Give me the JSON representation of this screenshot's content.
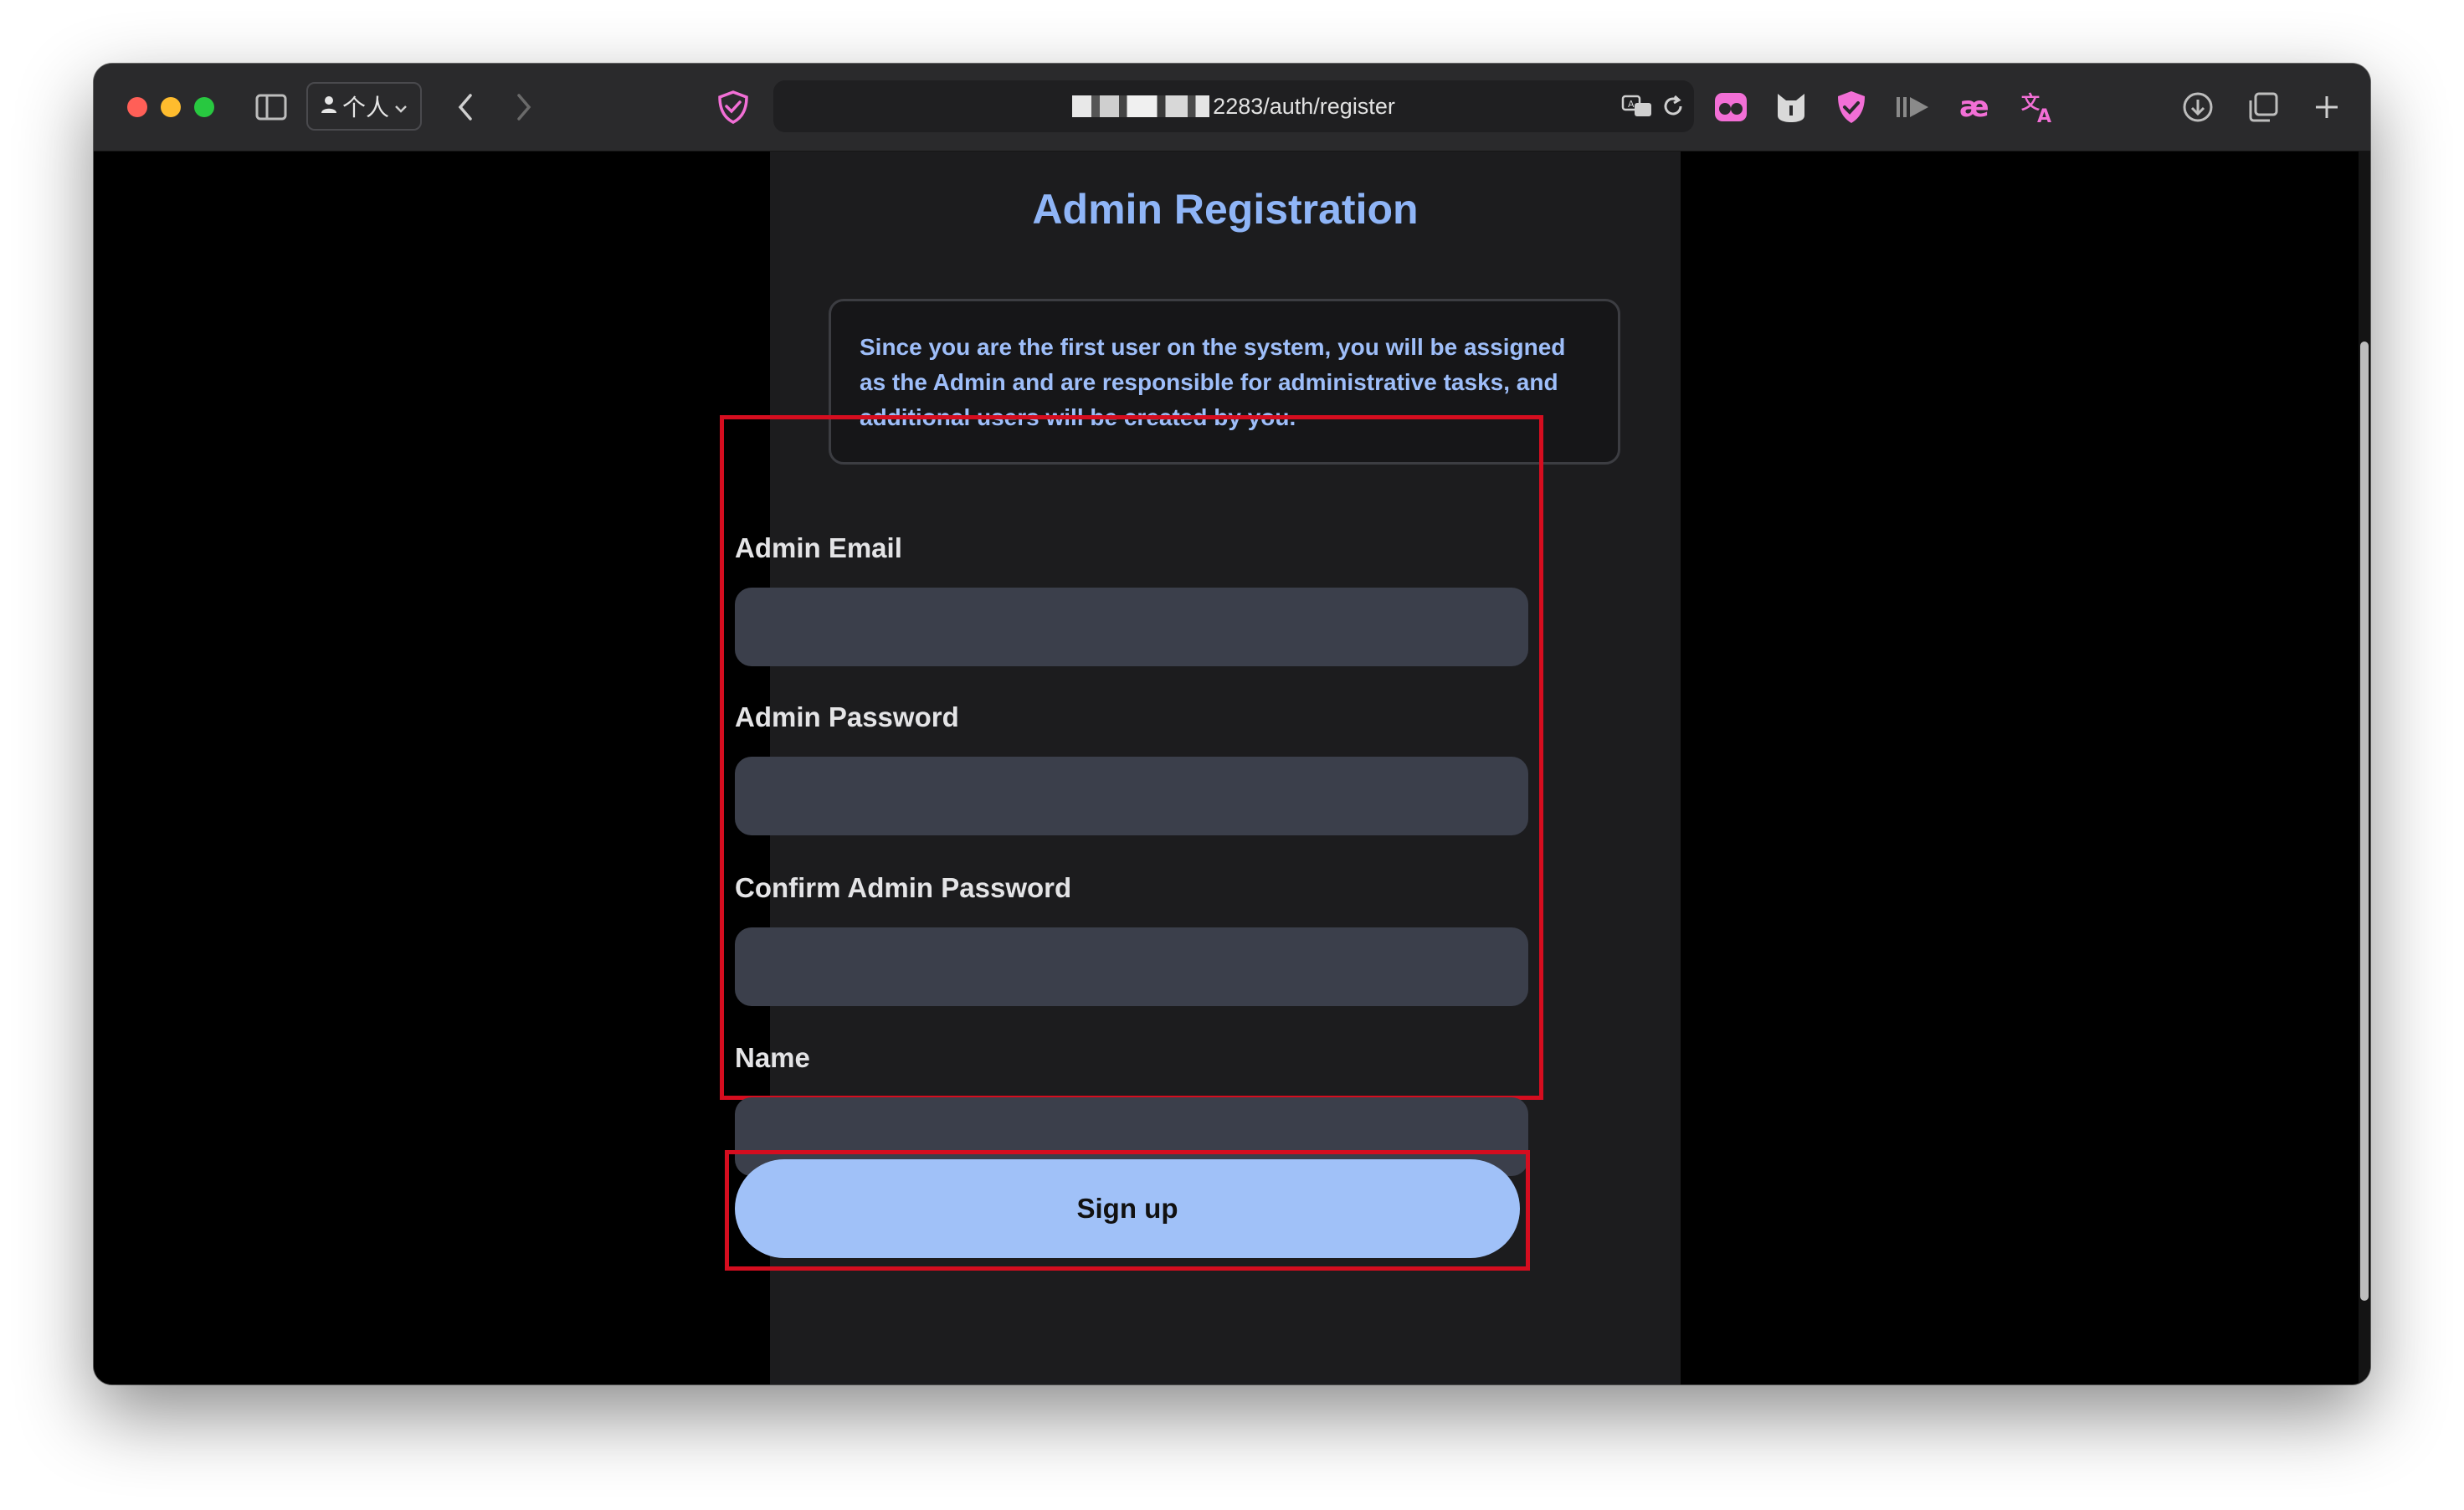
{
  "browser": {
    "profile_label": "个人",
    "url": "2283/auth/register",
    "colors": {
      "close": "#ff5f57",
      "minimize": "#febc2e",
      "maximize": "#28c840",
      "extension_accent": "#f26fd6"
    },
    "icons": [
      "sidebar-icon",
      "person-icon",
      "chevron-down-icon",
      "back-icon",
      "forward-icon",
      "shield-check-icon",
      "translate-icon",
      "reload-icon",
      "eyes-extension-icon",
      "cat-extension-icon",
      "shield-extension-icon",
      "skip-extension-icon",
      "ae-extension-icon",
      "translate-extension-icon",
      "download-icon",
      "tabs-overview-icon",
      "new-tab-icon"
    ]
  },
  "page": {
    "title": "Admin Registration",
    "notice": "Since you are the first user on the system, you will be assigned as the Admin and are responsible for administrative tasks, and additional users will be created by you.",
    "fields": [
      {
        "label": "Admin Email",
        "value": "",
        "placeholder": ""
      },
      {
        "label": "Admin Password",
        "value": "",
        "placeholder": ""
      },
      {
        "label": "Confirm Admin Password",
        "value": "",
        "placeholder": ""
      },
      {
        "label": "Name",
        "value": "",
        "placeholder": ""
      }
    ],
    "submit_label": "Sign up",
    "colors": {
      "title": "#8fb5f7",
      "notice_text": "#9ebef9",
      "input_bg": "#3b3f4b",
      "button_bg": "#a0c1f8",
      "highlight": "#d50d1f"
    }
  }
}
